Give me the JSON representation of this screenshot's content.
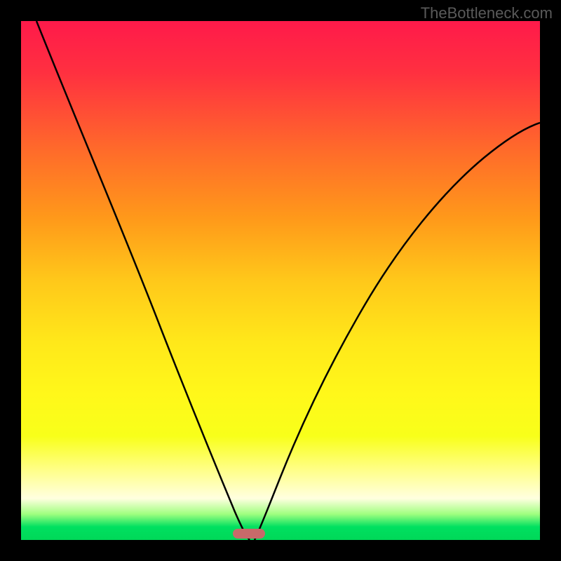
{
  "watermark": "TheBottleneck.com",
  "chart_data": {
    "type": "line",
    "title": "",
    "xlabel": "",
    "ylabel": "",
    "x_range": [
      0,
      100
    ],
    "y_range": [
      0,
      100
    ],
    "background_gradient": {
      "top": "#ff1a4a",
      "upper_mid": "#ff991a",
      "mid": "#ffe81a",
      "lower_mid": "#ffffb0",
      "bottom": "#00d858"
    },
    "series": [
      {
        "name": "left-branch",
        "description": "Descending curve from top-left to valley",
        "x": [
          3,
          10,
          18,
          25,
          32,
          38,
          42,
          44
        ],
        "y": [
          100,
          82,
          63,
          46,
          30,
          15,
          4,
          0
        ]
      },
      {
        "name": "right-branch",
        "description": "Ascending curve from valley to upper-right",
        "x": [
          45,
          48,
          53,
          60,
          68,
          77,
          86,
          95,
          100
        ],
        "y": [
          0,
          6,
          18,
          34,
          49,
          61,
          70,
          77,
          80
        ]
      }
    ],
    "valley_marker": {
      "x_center": 44,
      "y": 0,
      "width_pct": 6,
      "color": "#c76a6a"
    },
    "curve_color": "#000000"
  }
}
